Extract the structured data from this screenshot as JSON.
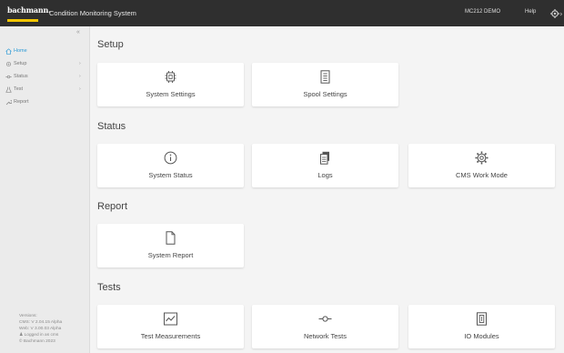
{
  "header": {
    "logo_text": "bachmann.",
    "app_title": "Condition Monitoring System",
    "device": "MC212 DEMO",
    "help": "Help",
    "settings_icon": "gear-icon"
  },
  "sidebar": {
    "collapse": "«",
    "items": [
      {
        "label": "Home",
        "icon": "home-icon",
        "chevron": ""
      },
      {
        "label": "Setup",
        "icon": "gear-icon",
        "chevron": "›"
      },
      {
        "label": "Status",
        "icon": "status-icon",
        "chevron": "›"
      },
      {
        "label": "Test",
        "icon": "flask-icon",
        "chevron": "›"
      },
      {
        "label": "Report",
        "icon": "wrench-icon",
        "chevron": ""
      }
    ],
    "footer": {
      "versions": "Versions:",
      "cms": "CMS: V 2.04.15 Alpha",
      "web": "Web: V 3.00.03 Alpha",
      "logged_in": "Logged in as cms",
      "copyright": "© Bachmann 2023"
    }
  },
  "sections": [
    {
      "title": "Setup",
      "cards": [
        {
          "label": "System Settings",
          "icon": "chip-icon"
        },
        {
          "label": "Spool Settings",
          "icon": "document-list-icon"
        }
      ]
    },
    {
      "title": "Status",
      "cards": [
        {
          "label": "System Status",
          "icon": "info-icon"
        },
        {
          "label": "Logs",
          "icon": "copy-icon"
        },
        {
          "label": "CMS Work Mode",
          "icon": "gear-icon"
        }
      ]
    },
    {
      "title": "Report",
      "cards": [
        {
          "label": "System Report",
          "icon": "file-icon"
        }
      ]
    },
    {
      "title": "Tests",
      "cards": [
        {
          "label": "Test Measurements",
          "icon": "chart-icon"
        },
        {
          "label": "Network Tests",
          "icon": "network-icon"
        },
        {
          "label": "IO Modules",
          "icon": "module-icon"
        }
      ]
    }
  ],
  "colors": {
    "accent": "#2e9bd6",
    "brand_yellow": "#f2c500",
    "topbar": "#2f2f2f"
  }
}
